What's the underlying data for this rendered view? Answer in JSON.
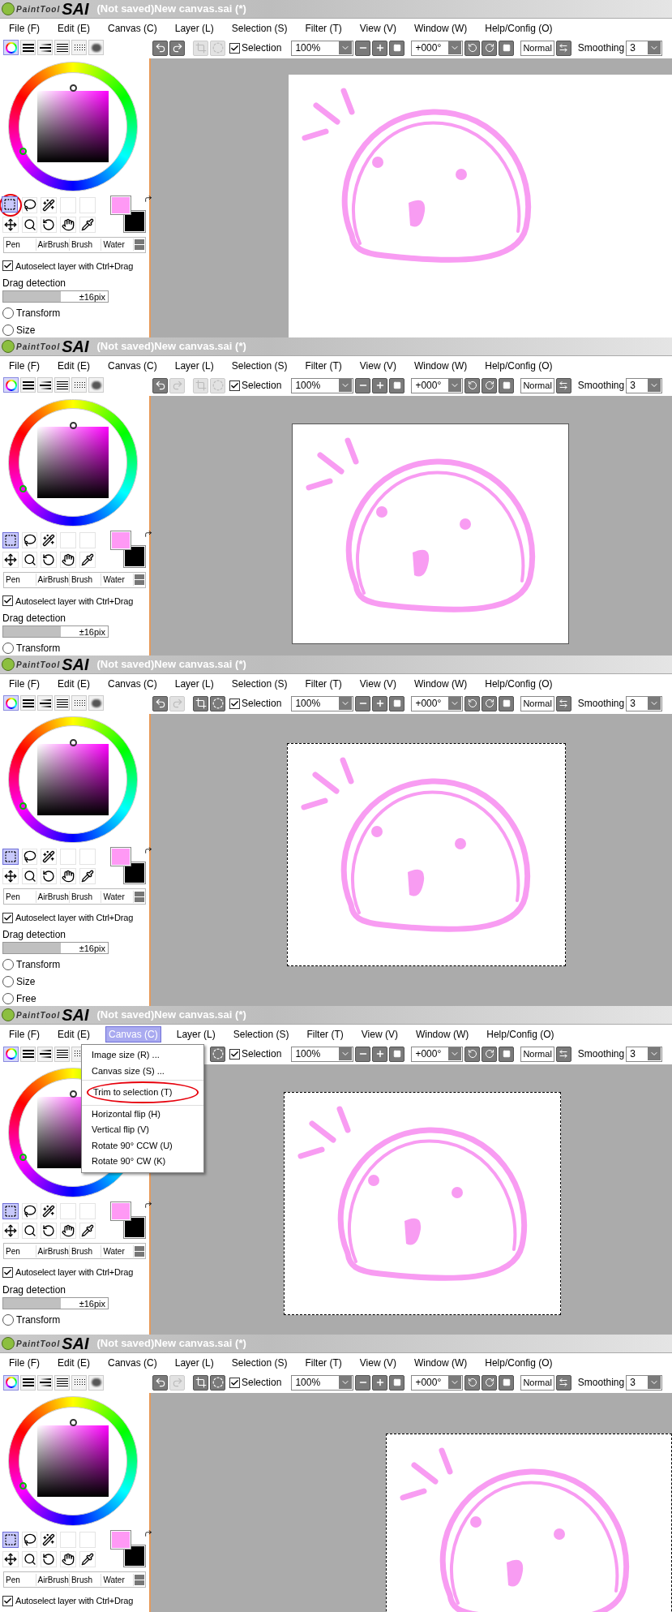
{
  "panels": [
    {
      "logo": {
        "small": "PaintTool",
        "big": "SAI"
      },
      "title": "(Not saved)New canvas.sai (*)",
      "menu": [
        {
          "label": "File (F)",
          "selected": false
        },
        {
          "label": "Edit (E)",
          "selected": false
        },
        {
          "label": "Canvas (C)",
          "selected": false
        },
        {
          "label": "Layer (L)",
          "selected": false
        },
        {
          "label": "Selection (S)",
          "selected": false
        },
        {
          "label": "Filter (T)",
          "selected": false
        },
        {
          "label": "View (V)",
          "selected": false
        },
        {
          "label": "Window (W)",
          "selected": false
        },
        {
          "label": "Help/Config (O)",
          "selected": false
        }
      ],
      "color_tabs": [
        {
          "kind": "wheel",
          "selected": true
        },
        {
          "kind": "bars",
          "selected": false
        },
        {
          "kind": "bars2",
          "selected": false
        },
        {
          "kind": "list",
          "selected": false
        },
        {
          "kind": "grid",
          "selected": false
        },
        {
          "kind": "blot",
          "selected": false
        }
      ],
      "toolbar": {
        "buttons": [
          {
            "kind": "undo",
            "disabled": false
          },
          {
            "kind": "redo",
            "disabled": false
          },
          {
            "kind": "crop",
            "disabled": true
          },
          {
            "kind": "deselect",
            "disabled": true
          }
        ],
        "selection": {
          "label": "Selection",
          "checked": true
        },
        "zoom": "100%",
        "angle": "+000°",
        "blend": "Normal",
        "smoothing_label": "Smoothing",
        "smoothing": "3"
      },
      "tools": [
        {
          "kind": "rect-select",
          "selected": true,
          "circled": true
        },
        {
          "kind": "lasso",
          "selected": false,
          "circled": false
        },
        {
          "kind": "wand",
          "selected": false,
          "circled": false
        },
        {
          "kind": "empty",
          "selected": false,
          "circled": false
        },
        {
          "kind": "empty",
          "selected": false,
          "circled": false
        },
        {
          "kind": "move",
          "selected": false,
          "circled": false
        },
        {
          "kind": "zoom",
          "selected": false,
          "circled": false
        },
        {
          "kind": "rotate",
          "selected": false,
          "circled": false
        },
        {
          "kind": "hand",
          "selected": false,
          "circled": false
        },
        {
          "kind": "eyedropper",
          "selected": false,
          "circled": false
        }
      ],
      "brushes": [
        "Pen",
        "AirBrush",
        "Brush",
        "Water"
      ],
      "autoselect": {
        "label": "Autoselect layer with Ctrl+Drag",
        "checked": true
      },
      "drag_detection": {
        "label": "Drag detection",
        "level": 0.55,
        "reading": "±16pix"
      },
      "options": [
        {
          "label": "Transform",
          "selected": false
        },
        {
          "label": "Size",
          "selected": false
        }
      ],
      "canvas": {
        "border": false,
        "marquee": false
      }
    },
    {
      "logo": {
        "small": "PaintTool",
        "big": "SAI"
      },
      "title": "(Not saved)New canvas.sai (*)",
      "menu": [
        {
          "label": "File (F)",
          "selected": false
        },
        {
          "label": "Edit (E)",
          "selected": false
        },
        {
          "label": "Canvas (C)",
          "selected": false
        },
        {
          "label": "Layer (L)",
          "selected": false
        },
        {
          "label": "Selection (S)",
          "selected": false
        },
        {
          "label": "Filter (T)",
          "selected": false
        },
        {
          "label": "View (V)",
          "selected": false
        },
        {
          "label": "Window (W)",
          "selected": false
        },
        {
          "label": "Help/Config (O)",
          "selected": false
        }
      ],
      "color_tabs": [
        {
          "kind": "wheel",
          "selected": true
        },
        {
          "kind": "bars",
          "selected": false
        },
        {
          "kind": "bars2",
          "selected": false
        },
        {
          "kind": "list",
          "selected": false
        },
        {
          "kind": "grid",
          "selected": false
        },
        {
          "kind": "blot",
          "selected": false
        }
      ],
      "toolbar": {
        "buttons": [
          {
            "kind": "undo",
            "disabled": false
          },
          {
            "kind": "redo",
            "disabled": true
          },
          {
            "kind": "crop",
            "disabled": true
          },
          {
            "kind": "deselect",
            "disabled": true
          }
        ],
        "selection": {
          "label": "Selection",
          "checked": true
        },
        "zoom": "100%",
        "angle": "+000°",
        "blend": "Normal",
        "smoothing_label": "Smoothing",
        "smoothing": "3"
      },
      "tools": [
        {
          "kind": "rect-select",
          "selected": true,
          "circled": false
        },
        {
          "kind": "lasso",
          "selected": false,
          "circled": false
        },
        {
          "kind": "wand",
          "selected": false,
          "circled": false
        },
        {
          "kind": "empty",
          "selected": false,
          "circled": false
        },
        {
          "kind": "empty",
          "selected": false,
          "circled": false
        },
        {
          "kind": "move",
          "selected": false,
          "circled": false
        },
        {
          "kind": "zoom",
          "selected": false,
          "circled": false
        },
        {
          "kind": "rotate",
          "selected": false,
          "circled": false
        },
        {
          "kind": "hand",
          "selected": false,
          "circled": false
        },
        {
          "kind": "eyedropper",
          "selected": false,
          "circled": false
        }
      ],
      "brushes": [
        "Pen",
        "AirBrush",
        "Brush",
        "Water"
      ],
      "autoselect": {
        "label": "Autoselect layer with Ctrl+Drag",
        "checked": true
      },
      "drag_detection": {
        "label": "Drag detection",
        "level": 0.55,
        "reading": "±16pix"
      },
      "options": [
        {
          "label": "Transform",
          "selected": false
        }
      ],
      "canvas": {
        "border": true,
        "marquee": false
      }
    },
    {
      "logo": {
        "small": "PaintTool",
        "big": "SAI"
      },
      "title": "(Not saved)New canvas.sai (*)",
      "menu": [
        {
          "label": "File (F)",
          "selected": false
        },
        {
          "label": "Edit (E)",
          "selected": false
        },
        {
          "label": "Canvas (C)",
          "selected": false
        },
        {
          "label": "Layer (L)",
          "selected": false
        },
        {
          "label": "Selection (S)",
          "selected": false
        },
        {
          "label": "Filter (T)",
          "selected": false
        },
        {
          "label": "View (V)",
          "selected": false
        },
        {
          "label": "Window (W)",
          "selected": false
        },
        {
          "label": "Help/Config (O)",
          "selected": false
        }
      ],
      "color_tabs": [
        {
          "kind": "wheel",
          "selected": true
        },
        {
          "kind": "bars",
          "selected": false
        },
        {
          "kind": "bars2",
          "selected": false
        },
        {
          "kind": "list",
          "selected": false
        },
        {
          "kind": "grid",
          "selected": false
        },
        {
          "kind": "blot",
          "selected": false
        }
      ],
      "toolbar": {
        "buttons": [
          {
            "kind": "undo",
            "disabled": false
          },
          {
            "kind": "redo",
            "disabled": true
          },
          {
            "kind": "crop",
            "disabled": false
          },
          {
            "kind": "deselect",
            "disabled": false
          }
        ],
        "selection": {
          "label": "Selection",
          "checked": true
        },
        "zoom": "100%",
        "angle": "+000°",
        "blend": "Normal",
        "smoothing_label": "Smoothing",
        "smoothing": "3"
      },
      "tools": [
        {
          "kind": "rect-select",
          "selected": true,
          "circled": false
        },
        {
          "kind": "lasso",
          "selected": false,
          "circled": false
        },
        {
          "kind": "wand",
          "selected": false,
          "circled": false
        },
        {
          "kind": "empty",
          "selected": false,
          "circled": false
        },
        {
          "kind": "empty",
          "selected": false,
          "circled": false
        },
        {
          "kind": "move",
          "selected": false,
          "circled": false
        },
        {
          "kind": "zoom",
          "selected": false,
          "circled": false
        },
        {
          "kind": "rotate",
          "selected": false,
          "circled": false
        },
        {
          "kind": "hand",
          "selected": false,
          "circled": false
        },
        {
          "kind": "eyedropper",
          "selected": false,
          "circled": false
        }
      ],
      "brushes": [
        "Pen",
        "AirBrush",
        "Brush",
        "Water"
      ],
      "autoselect": {
        "label": "Autoselect layer with Ctrl+Drag",
        "checked": true
      },
      "drag_detection": {
        "label": "Drag detection",
        "level": 0.55,
        "reading": "±16pix"
      },
      "options": [
        {
          "label": "Transform",
          "selected": false
        },
        {
          "label": "Size",
          "selected": false
        },
        {
          "label": "Free",
          "selected": false
        }
      ],
      "canvas": {
        "border": false,
        "marquee": true
      }
    },
    {
      "logo": {
        "small": "PaintTool",
        "big": "SAI"
      },
      "title": "(Not saved)New canvas.sai (*)",
      "menu": [
        {
          "label": "File (F)",
          "selected": false
        },
        {
          "label": "Edit (E)",
          "selected": false
        },
        {
          "label": "Canvas (C)",
          "selected": true
        },
        {
          "label": "Layer (L)",
          "selected": false
        },
        {
          "label": "Selection (S)",
          "selected": false
        },
        {
          "label": "Filter (T)",
          "selected": false
        },
        {
          "label": "View (V)",
          "selected": false
        },
        {
          "label": "Window (W)",
          "selected": false
        },
        {
          "label": "Help/Config (O)",
          "selected": false
        }
      ],
      "color_tabs": [
        {
          "kind": "wheel",
          "selected": true
        },
        {
          "kind": "bars",
          "selected": false
        },
        {
          "kind": "bars2",
          "selected": false
        },
        {
          "kind": "list",
          "selected": false
        },
        {
          "kind": "grid",
          "selected": false
        }
      ],
      "toolbar": {
        "buttons": [
          {
            "kind": "deselect",
            "disabled": false
          }
        ],
        "selection": {
          "label": "Selection",
          "checked": true
        },
        "zoom": "100%",
        "angle": "+000°",
        "blend": "Normal",
        "smoothing_label": "Smoothing",
        "smoothing": "3"
      },
      "tools": [
        {
          "kind": "rect-select",
          "selected": true,
          "circled": false
        },
        {
          "kind": "lasso",
          "selected": false,
          "circled": false
        },
        {
          "kind": "wand",
          "selected": false,
          "circled": false
        },
        {
          "kind": "empty",
          "selected": false,
          "circled": false
        },
        {
          "kind": "empty",
          "selected": false,
          "circled": false
        },
        {
          "kind": "move",
          "selected": false,
          "circled": false
        },
        {
          "kind": "zoom",
          "selected": false,
          "circled": false
        },
        {
          "kind": "rotate",
          "selected": false,
          "circled": false
        },
        {
          "kind": "hand",
          "selected": false,
          "circled": false
        },
        {
          "kind": "eyedropper",
          "selected": false,
          "circled": false
        }
      ],
      "brushes": [
        "Pen",
        "AirBrush",
        "Brush",
        "Water"
      ],
      "autoselect": {
        "label": "Autoselect layer with Ctrl+Drag",
        "checked": true
      },
      "drag_detection": {
        "label": "Drag detection",
        "level": 0.55,
        "reading": "±16pix"
      },
      "options": [
        {
          "label": "Transform",
          "selected": false
        }
      ],
      "canvas": {
        "border": false,
        "marquee": true
      },
      "dropdown": [
        [
          {
            "label": "Image size (R) ...",
            "circled": false
          },
          {
            "label": "Canvas size (S) ...",
            "circled": false
          }
        ],
        [
          {
            "label": "Trim to selection (T)",
            "circled": true
          }
        ],
        [
          {
            "label": "Horizontal flip (H)",
            "circled": false
          },
          {
            "label": "Vertical flip (V)",
            "circled": false
          },
          {
            "label": "Rotate 90° CCW (U)",
            "circled": false
          },
          {
            "label": "Rotate 90° CW (K)",
            "circled": false
          }
        ]
      ]
    },
    {
      "logo": {
        "small": "PaintTool",
        "big": "SAI"
      },
      "title": "(Not saved)New canvas.sai (*)",
      "menu": [
        {
          "label": "File (F)",
          "selected": false
        },
        {
          "label": "Edit (E)",
          "selected": false
        },
        {
          "label": "Canvas (C)",
          "selected": false
        },
        {
          "label": "Layer (L)",
          "selected": false
        },
        {
          "label": "Selection (S)",
          "selected": false
        },
        {
          "label": "Filter (T)",
          "selected": false
        },
        {
          "label": "View (V)",
          "selected": false
        },
        {
          "label": "Window (W)",
          "selected": false
        },
        {
          "label": "Help/Config (O)",
          "selected": false
        }
      ],
      "color_tabs": [
        {
          "kind": "wheel",
          "selected": true
        },
        {
          "kind": "bars",
          "selected": false
        },
        {
          "kind": "bars2",
          "selected": false
        },
        {
          "kind": "list",
          "selected": false
        },
        {
          "kind": "grid",
          "selected": false
        },
        {
          "kind": "blot",
          "selected": false
        }
      ],
      "toolbar": {
        "buttons": [
          {
            "kind": "undo",
            "disabled": false
          },
          {
            "kind": "redo",
            "disabled": true
          },
          {
            "kind": "crop",
            "disabled": false
          },
          {
            "kind": "deselect",
            "disabled": false
          }
        ],
        "selection": {
          "label": "Selection",
          "checked": true
        },
        "zoom": "100%",
        "angle": "+000°",
        "blend": "Normal",
        "smoothing_label": "Smoothing",
        "smoothing": "3"
      },
      "tools": [
        {
          "kind": "rect-select",
          "selected": true,
          "circled": false
        },
        {
          "kind": "lasso",
          "selected": false,
          "circled": false
        },
        {
          "kind": "wand",
          "selected": false,
          "circled": false
        },
        {
          "kind": "empty",
          "selected": false,
          "circled": false
        },
        {
          "kind": "empty",
          "selected": false,
          "circled": false
        },
        {
          "kind": "move",
          "selected": false,
          "circled": false
        },
        {
          "kind": "zoom",
          "selected": false,
          "circled": false
        },
        {
          "kind": "rotate",
          "selected": false,
          "circled": false
        },
        {
          "kind": "hand",
          "selected": false,
          "circled": false
        },
        {
          "kind": "eyedropper",
          "selected": false,
          "circled": false
        }
      ],
      "brushes": [
        "Pen",
        "AirBrush",
        "Brush",
        "Water"
      ],
      "autoselect": {
        "label": "Autoselect layer with Ctrl+Drag",
        "checked": true
      },
      "canvas": {
        "border": false,
        "marquee": true
      }
    }
  ]
}
